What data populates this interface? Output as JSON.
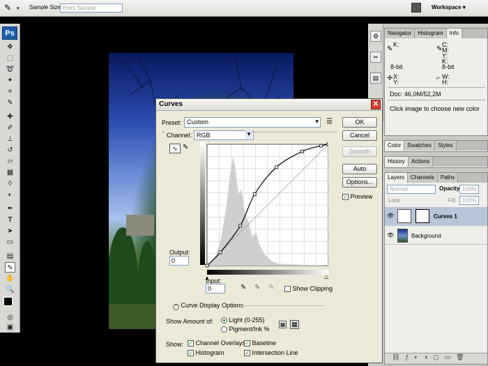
{
  "options_bar": {
    "sample_size_label": "Sample Size:",
    "sample_size_value": "Point Sample",
    "workspace_label": "Workspace"
  },
  "tools": {
    "app_logo": "Ps"
  },
  "info_panel": {
    "tabs": [
      "Navigator",
      "Histogram",
      "Info"
    ],
    "active_tab": "Info",
    "k_label": "K:",
    "c_label": "C:",
    "m_label": "M:",
    "y_label": "Y:",
    "k2_label": "K:",
    "bit1": "8-bit",
    "bit2": "8-bit",
    "x_label": "X:",
    "y2_label": "Y:",
    "w_label": "W:",
    "h_label": "H:",
    "doc": "Doc: 46,0M/52,2M",
    "hint": "Click image to choose new color"
  },
  "color_panel": {
    "tabs": [
      "Color",
      "Swatches",
      "Styles"
    ]
  },
  "history_panel": {
    "tabs": [
      "History",
      "Actions"
    ]
  },
  "layers_panel": {
    "tabs": [
      "Layers",
      "Channels",
      "Paths"
    ],
    "blend_mode": "Normal",
    "opacity_label": "Opacity:",
    "opacity_value": "100%",
    "lock_label": "Lock:",
    "fill_label": "Fill:",
    "fill_value": "100%",
    "layers": [
      {
        "name": "Curves 1"
      },
      {
        "name": "Background"
      }
    ]
  },
  "curves_dialog": {
    "title": "Curves",
    "preset_label": "Preset:",
    "preset_value": "Custom",
    "channel_label": "Channel:",
    "channel_value": "RGB",
    "ok": "OK",
    "cancel": "Cancel",
    "smooth": "Smooth",
    "auto": "Auto",
    "options": "Options...",
    "preview_label": "Preview",
    "output_label": "Output:",
    "output_value": "0",
    "input_label": "Input:",
    "input_value": "0",
    "show_clipping_label": "Show Clipping",
    "display_options_label": "Curve Display Options",
    "show_amount_label": "Show Amount of:",
    "light_label": "Light  (0-255)",
    "pigment_label": "Pigment/Ink %",
    "show_label": "Show:",
    "channel_overlays": "Channel Overlays",
    "baseline": "Baseline",
    "histogram": "Histogram",
    "intersection_line": "Intersection Line",
    "curve_points": [
      [
        0,
        0
      ],
      [
        28,
        28
      ],
      [
        70,
        84
      ],
      [
        100,
        150
      ],
      [
        146,
        207
      ],
      [
        200,
        240
      ],
      [
        240,
        252
      ],
      [
        255,
        255
      ]
    ]
  }
}
